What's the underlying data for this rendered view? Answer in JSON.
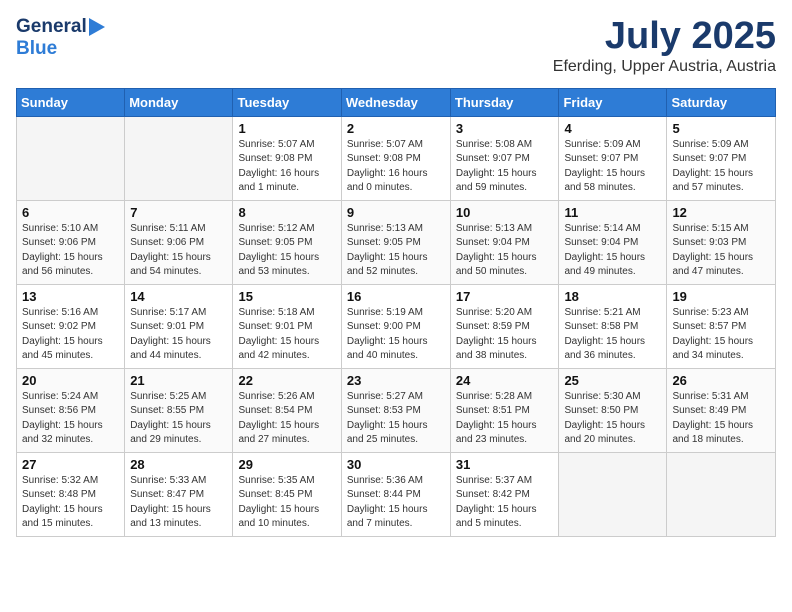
{
  "header": {
    "logo_general": "General",
    "logo_blue": "Blue",
    "title": "July 2025",
    "subtitle": "Eferding, Upper Austria, Austria"
  },
  "weekdays": [
    "Sunday",
    "Monday",
    "Tuesday",
    "Wednesday",
    "Thursday",
    "Friday",
    "Saturday"
  ],
  "weeks": [
    [
      {
        "day": "",
        "detail": ""
      },
      {
        "day": "",
        "detail": ""
      },
      {
        "day": "1",
        "detail": "Sunrise: 5:07 AM\nSunset: 9:08 PM\nDaylight: 16 hours\nand 1 minute."
      },
      {
        "day": "2",
        "detail": "Sunrise: 5:07 AM\nSunset: 9:08 PM\nDaylight: 16 hours\nand 0 minutes."
      },
      {
        "day": "3",
        "detail": "Sunrise: 5:08 AM\nSunset: 9:07 PM\nDaylight: 15 hours\nand 59 minutes."
      },
      {
        "day": "4",
        "detail": "Sunrise: 5:09 AM\nSunset: 9:07 PM\nDaylight: 15 hours\nand 58 minutes."
      },
      {
        "day": "5",
        "detail": "Sunrise: 5:09 AM\nSunset: 9:07 PM\nDaylight: 15 hours\nand 57 minutes."
      }
    ],
    [
      {
        "day": "6",
        "detail": "Sunrise: 5:10 AM\nSunset: 9:06 PM\nDaylight: 15 hours\nand 56 minutes."
      },
      {
        "day": "7",
        "detail": "Sunrise: 5:11 AM\nSunset: 9:06 PM\nDaylight: 15 hours\nand 54 minutes."
      },
      {
        "day": "8",
        "detail": "Sunrise: 5:12 AM\nSunset: 9:05 PM\nDaylight: 15 hours\nand 53 minutes."
      },
      {
        "day": "9",
        "detail": "Sunrise: 5:13 AM\nSunset: 9:05 PM\nDaylight: 15 hours\nand 52 minutes."
      },
      {
        "day": "10",
        "detail": "Sunrise: 5:13 AM\nSunset: 9:04 PM\nDaylight: 15 hours\nand 50 minutes."
      },
      {
        "day": "11",
        "detail": "Sunrise: 5:14 AM\nSunset: 9:04 PM\nDaylight: 15 hours\nand 49 minutes."
      },
      {
        "day": "12",
        "detail": "Sunrise: 5:15 AM\nSunset: 9:03 PM\nDaylight: 15 hours\nand 47 minutes."
      }
    ],
    [
      {
        "day": "13",
        "detail": "Sunrise: 5:16 AM\nSunset: 9:02 PM\nDaylight: 15 hours\nand 45 minutes."
      },
      {
        "day": "14",
        "detail": "Sunrise: 5:17 AM\nSunset: 9:01 PM\nDaylight: 15 hours\nand 44 minutes."
      },
      {
        "day": "15",
        "detail": "Sunrise: 5:18 AM\nSunset: 9:01 PM\nDaylight: 15 hours\nand 42 minutes."
      },
      {
        "day": "16",
        "detail": "Sunrise: 5:19 AM\nSunset: 9:00 PM\nDaylight: 15 hours\nand 40 minutes."
      },
      {
        "day": "17",
        "detail": "Sunrise: 5:20 AM\nSunset: 8:59 PM\nDaylight: 15 hours\nand 38 minutes."
      },
      {
        "day": "18",
        "detail": "Sunrise: 5:21 AM\nSunset: 8:58 PM\nDaylight: 15 hours\nand 36 minutes."
      },
      {
        "day": "19",
        "detail": "Sunrise: 5:23 AM\nSunset: 8:57 PM\nDaylight: 15 hours\nand 34 minutes."
      }
    ],
    [
      {
        "day": "20",
        "detail": "Sunrise: 5:24 AM\nSunset: 8:56 PM\nDaylight: 15 hours\nand 32 minutes."
      },
      {
        "day": "21",
        "detail": "Sunrise: 5:25 AM\nSunset: 8:55 PM\nDaylight: 15 hours\nand 29 minutes."
      },
      {
        "day": "22",
        "detail": "Sunrise: 5:26 AM\nSunset: 8:54 PM\nDaylight: 15 hours\nand 27 minutes."
      },
      {
        "day": "23",
        "detail": "Sunrise: 5:27 AM\nSunset: 8:53 PM\nDaylight: 15 hours\nand 25 minutes."
      },
      {
        "day": "24",
        "detail": "Sunrise: 5:28 AM\nSunset: 8:51 PM\nDaylight: 15 hours\nand 23 minutes."
      },
      {
        "day": "25",
        "detail": "Sunrise: 5:30 AM\nSunset: 8:50 PM\nDaylight: 15 hours\nand 20 minutes."
      },
      {
        "day": "26",
        "detail": "Sunrise: 5:31 AM\nSunset: 8:49 PM\nDaylight: 15 hours\nand 18 minutes."
      }
    ],
    [
      {
        "day": "27",
        "detail": "Sunrise: 5:32 AM\nSunset: 8:48 PM\nDaylight: 15 hours\nand 15 minutes."
      },
      {
        "day": "28",
        "detail": "Sunrise: 5:33 AM\nSunset: 8:47 PM\nDaylight: 15 hours\nand 13 minutes."
      },
      {
        "day": "29",
        "detail": "Sunrise: 5:35 AM\nSunset: 8:45 PM\nDaylight: 15 hours\nand 10 minutes."
      },
      {
        "day": "30",
        "detail": "Sunrise: 5:36 AM\nSunset: 8:44 PM\nDaylight: 15 hours\nand 7 minutes."
      },
      {
        "day": "31",
        "detail": "Sunrise: 5:37 AM\nSunset: 8:42 PM\nDaylight: 15 hours\nand 5 minutes."
      },
      {
        "day": "",
        "detail": ""
      },
      {
        "day": "",
        "detail": ""
      }
    ]
  ]
}
